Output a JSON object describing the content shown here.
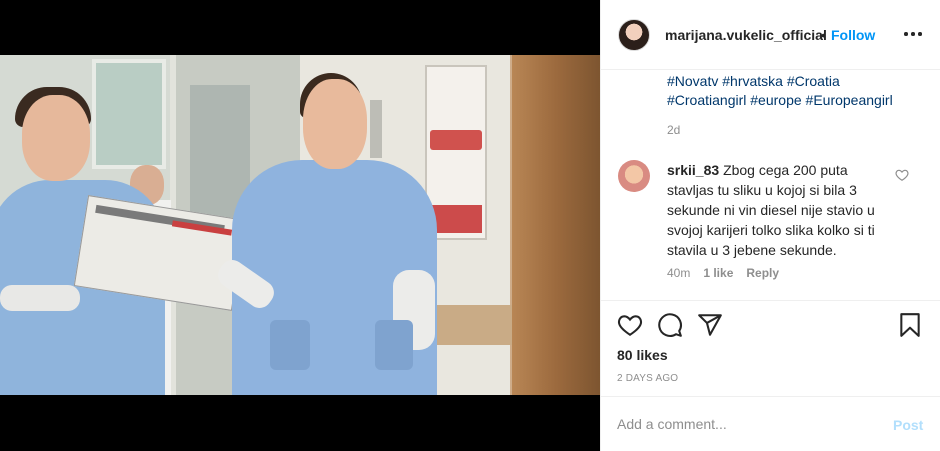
{
  "post": {
    "username": "marijana.vukelic_official",
    "separator": "•",
    "follow_label": "Follow",
    "more_icon": "more-options-icon"
  },
  "caption": {
    "line1": "#Novatv #hrvatska #Croatia",
    "line2": "#Croatiangirl #europe #Europeangirl",
    "age": "2d"
  },
  "comment": {
    "username": "srkii_83",
    "text": "Zbog cega 200 puta stavljas tu sliku u kojoj si bila 3 sekunde ni vin diesel nije stavio u svojoj karijeri tolko slika kolko si ti stavila u 3 jebene sekunde.",
    "time": "40m",
    "likes": "1 like",
    "reply_label": "Reply"
  },
  "actions": {
    "like_icon": "heart-icon",
    "comment_icon": "comment-icon",
    "share_icon": "share-icon",
    "save_icon": "bookmark-icon"
  },
  "stats": {
    "likes": "80 likes",
    "date": "2 DAYS AGO"
  },
  "add_comment": {
    "placeholder": "Add a comment...",
    "post_label": "Post"
  },
  "colors": {
    "link_blue": "#0095f6",
    "hashtag": "#00376b",
    "muted": "#8e8e8e",
    "post_disabled": "#b2dffc"
  }
}
